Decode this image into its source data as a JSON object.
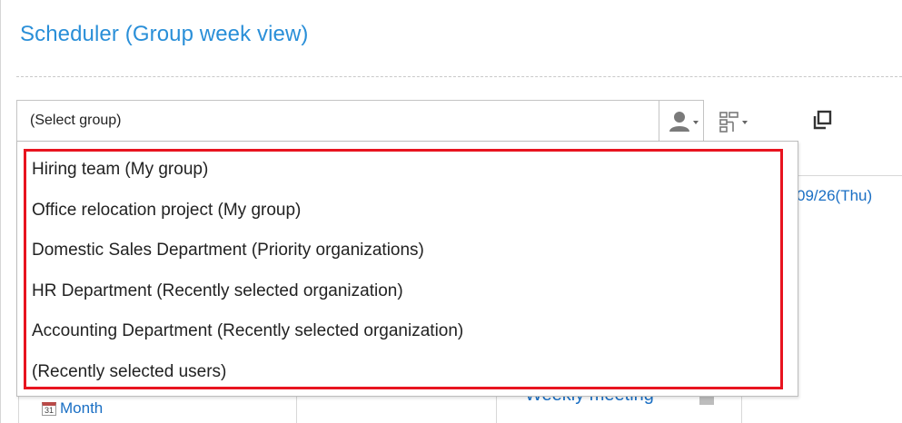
{
  "header": {
    "title": "Scheduler (Group week view)"
  },
  "group_selector": {
    "value": "(Select group)"
  },
  "toolbar": {
    "user_icon": "user-icon",
    "org_icon": "organization-icon",
    "copy_icon": "copy-icon"
  },
  "dropdown": {
    "options": [
      "Hiring team (My group)",
      "Office relocation project (My group)",
      "Domestic Sales Department (Priority organizations)",
      "HR Department (Recently selected organization)",
      "Accounting Department (Recently selected organization)",
      "(Recently selected users)"
    ],
    "highlight_color": "#e8141f"
  },
  "background": {
    "date_label": "09/26(Thu)",
    "month_link": "Month",
    "month_icon_text": "31",
    "weekly_meeting": "Weekly meeting"
  },
  "colors": {
    "title": "#2a8fd8",
    "link": "#1a6fc4"
  }
}
